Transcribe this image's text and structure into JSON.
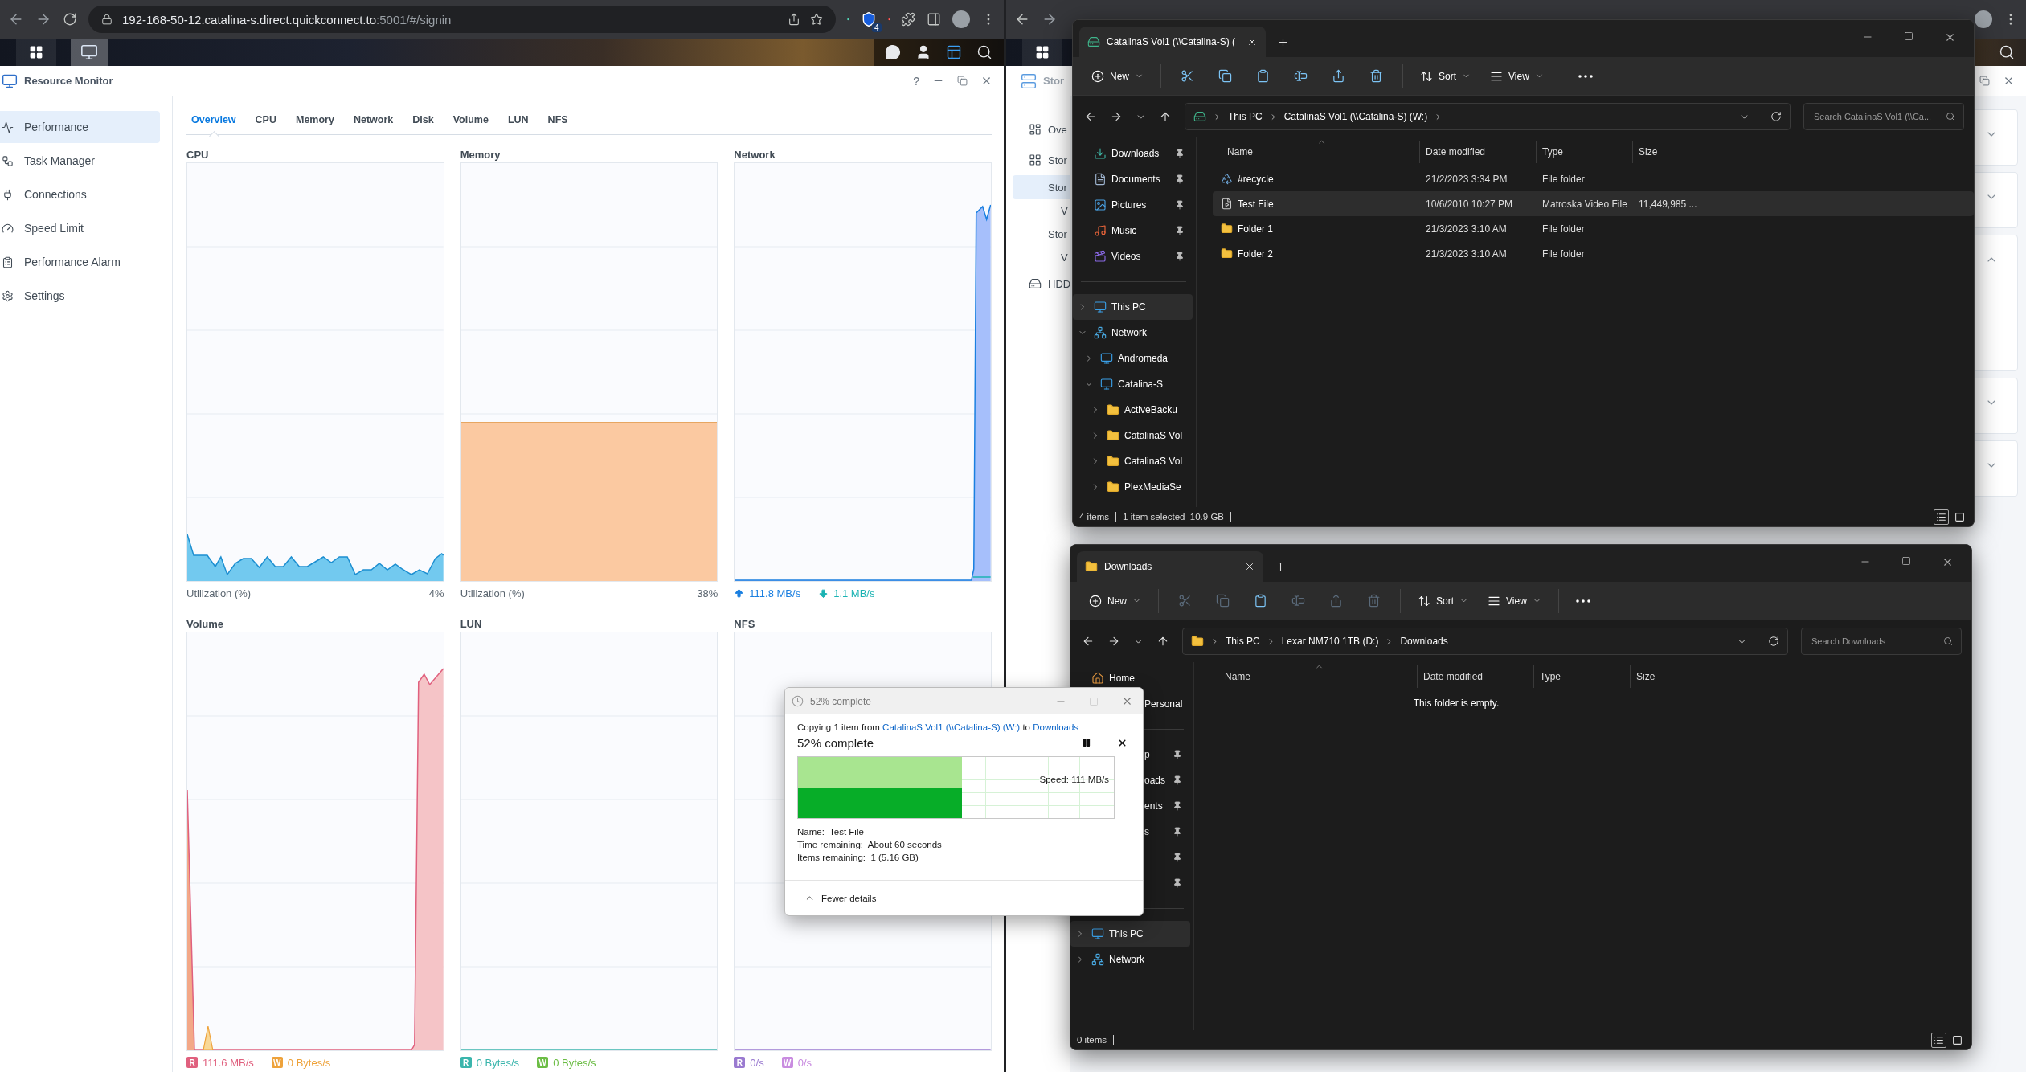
{
  "left_browser": {
    "url_host": "192-168-50-12.catalina-s.direct.quickconnect.to",
    "url_path": ":5001/#/signin",
    "extension_badge": "4"
  },
  "resource_monitor": {
    "title": "Resource Monitor",
    "help": "?",
    "sidebar": [
      {
        "label": "Performance",
        "kind": "performance",
        "selected": true
      },
      {
        "label": "Task Manager",
        "kind": "tasks",
        "selected": false
      },
      {
        "label": "Connections",
        "kind": "connections",
        "selected": false
      },
      {
        "label": "Speed Limit",
        "kind": "speed",
        "selected": false
      },
      {
        "label": "Performance Alarm",
        "kind": "alarm",
        "selected": false
      },
      {
        "label": "Settings",
        "kind": "settings",
        "selected": false
      }
    ],
    "tabs": [
      {
        "label": "Overview",
        "selected": true
      },
      {
        "label": "CPU",
        "selected": false
      },
      {
        "label": "Memory",
        "selected": false
      },
      {
        "label": "Network",
        "selected": false
      },
      {
        "label": "Disk",
        "selected": false
      },
      {
        "label": "Volume",
        "selected": false
      },
      {
        "label": "LUN",
        "selected": false
      },
      {
        "label": "NFS",
        "selected": false
      }
    ],
    "panels": [
      {
        "title": "CPU",
        "kind": "cpu",
        "caption": "Utilization (%)",
        "value": "4%"
      },
      {
        "title": "Memory",
        "kind": "memory",
        "caption": "Utilization (%)",
        "value": "38%"
      },
      {
        "title": "Network",
        "kind": "network",
        "legend": [
          {
            "kind": "up",
            "text": "111.8 MB/s",
            "color": "#1a7fe0"
          },
          {
            "kind": "down",
            "text": "1.1 MB/s",
            "color": "#1bb3b3"
          }
        ]
      },
      {
        "title": "Volume",
        "kind": "volume",
        "legend": [
          {
            "kind": "badge",
            "badge": "R",
            "text": "111.6 MB/s",
            "color": "#e0607e"
          },
          {
            "kind": "badge",
            "badge": "W",
            "text": "0 Bytes/s",
            "color": "#eea23a"
          }
        ]
      },
      {
        "title": "LUN",
        "kind": "flat",
        "legend": [
          {
            "kind": "badge",
            "badge": "R",
            "text": "0 Bytes/s",
            "color": "#3ab5ac"
          },
          {
            "kind": "badge",
            "badge": "W",
            "text": "0 Bytes/s",
            "color": "#6cbd45"
          }
        ]
      },
      {
        "title": "NFS",
        "kind": "flat",
        "legend": [
          {
            "kind": "badge",
            "badge": "R",
            "text": "0/s",
            "color": "#9a7ad0"
          },
          {
            "kind": "badge",
            "badge": "W",
            "text": "0/s",
            "color": "#c98ce0"
          }
        ]
      }
    ]
  },
  "right_browser": {
    "window_title": "Stor",
    "sidebar": [
      {
        "label": "Ove",
        "kind": "main",
        "selected": false
      },
      {
        "label": "Stor",
        "kind": "main",
        "selected": false
      },
      {
        "label": "Stor",
        "kind": "group",
        "selected": true
      },
      {
        "label": "V",
        "kind": "sub",
        "selected": false
      },
      {
        "label": "Stor",
        "kind": "group",
        "selected": false
      },
      {
        "label": "V",
        "kind": "sub",
        "selected": false
      },
      {
        "label": "HDD",
        "kind": "main",
        "selected": false
      }
    ],
    "cards": [
      {
        "expanded": false
      },
      {
        "expanded": false
      },
      {
        "expanded": true
      },
      {
        "expanded": false
      },
      {
        "expanded": false
      }
    ]
  },
  "explorers": [
    {
      "tab": {
        "title": "CatalinaS Vol1 (\\\\Catalina-S) (",
        "kind": "drive"
      },
      "menus": [
        "New",
        "Sort",
        "View"
      ],
      "actions": [
        {
          "kind": "cut",
          "disabled": false
        },
        {
          "kind": "copy",
          "disabled": false
        },
        {
          "kind": "paste",
          "disabled": false
        },
        {
          "kind": "rename",
          "disabled": false
        },
        {
          "kind": "share",
          "disabled": false
        },
        {
          "kind": "delete",
          "disabled": false
        }
      ],
      "location": {
        "kind": "drive",
        "path": [
          "This PC",
          "CatalinaS Vol1 (\\\\Catalina-S) (W:)"
        ]
      },
      "search_placeholder": "Search CatalinaS Vol1 (\\\\Ca...",
      "nav_groups": [
        [
          {
            "label": "Downloads",
            "kind": "download",
            "pinned": true,
            "selected": false
          },
          {
            "label": "Documents",
            "kind": "document",
            "pinned": true,
            "selected": false
          },
          {
            "label": "Pictures",
            "kind": "picture",
            "pinned": true,
            "selected": false
          },
          {
            "label": "Music",
            "kind": "music",
            "pinned": true,
            "selected": false
          },
          {
            "label": "Videos",
            "kind": "video",
            "pinned": true,
            "selected": false
          }
        ],
        [
          {
            "label": "This PC",
            "kind": "pc",
            "expanded": false,
            "pinned": false,
            "selected": true
          },
          {
            "label": "Network",
            "kind": "network",
            "expanded": true,
            "pinned": false,
            "selected": false,
            "children": [
              {
                "label": "Andromeda",
                "kind": "computer",
                "expanded": false,
                "pinned": false,
                "selected": false
              },
              {
                "label": "Catalina-S",
                "kind": "computer",
                "expanded": true,
                "pinned": false,
                "selected": false,
                "children": [
                  {
                    "label": "ActiveBacku",
                    "kind": "folder",
                    "expanded": false,
                    "pinned": false,
                    "selected": false
                  },
                  {
                    "label": "CatalinaS Vol",
                    "kind": "folder",
                    "expanded": false,
                    "pinned": false,
                    "selected": false
                  },
                  {
                    "label": "CatalinaS Vol",
                    "kind": "folder",
                    "expanded": false,
                    "pinned": false,
                    "selected": false
                  },
                  {
                    "label": "PlexMediaSe",
                    "kind": "folder",
                    "expanded": false,
                    "pinned": false,
                    "selected": false
                  }
                ]
              }
            ]
          }
        ]
      ],
      "columns": [
        "Name",
        "Date modified",
        "Type",
        "Size"
      ],
      "rows": [
        {
          "name": "#recycle",
          "kind": "recycle",
          "date": "21/2/2023 3:34 PM",
          "type": "File folder",
          "selected": false
        },
        {
          "name": "Test File",
          "kind": "video",
          "date": "10/6/2010 10:27 PM",
          "type": "Matroska Video File",
          "size": "11,449,985 ...",
          "selected": true
        },
        {
          "name": "Folder 1",
          "kind": "folder",
          "date": "21/3/2023 3:10 AM",
          "type": "File folder",
          "selected": false
        },
        {
          "name": "Folder 2",
          "kind": "folder",
          "date": "21/3/2023 3:10 AM",
          "type": "File folder",
          "selected": false
        }
      ],
      "status": [
        "4 items",
        "1 item selected  10.9 GB"
      ],
      "views": [
        {
          "kind": "details",
          "selected": true
        },
        {
          "kind": "tiles",
          "selected": false
        }
      ]
    },
    {
      "tab": {
        "title": "Downloads",
        "kind": "folder"
      },
      "menus": [
        "New",
        "Sort",
        "View"
      ],
      "actions": [
        {
          "kind": "cut",
          "disabled": true
        },
        {
          "kind": "copy",
          "disabled": true
        },
        {
          "kind": "paste",
          "disabled": false
        },
        {
          "kind": "rename",
          "disabled": true
        },
        {
          "kind": "share",
          "disabled": true
        },
        {
          "kind": "delete",
          "disabled": true
        }
      ],
      "location": {
        "kind": "folder",
        "path": [
          "This PC",
          "Lexar NM710 1TB (D:)",
          "Downloads"
        ]
      },
      "search_placeholder": "Search Downloads",
      "nav_groups": [
        [
          {
            "label": "Home",
            "kind": "home",
            "pinned": false,
            "selected": false
          },
          {
            "label": "Personal",
            "kind": "partial",
            "pinned": false,
            "selected": false
          }
        ],
        [
          {
            "label": "p",
            "kind": "partial",
            "pinned": true,
            "selected": false
          },
          {
            "label": "oads",
            "kind": "partial",
            "pinned": true,
            "selected": false
          },
          {
            "label": "ents",
            "kind": "partial",
            "pinned": true,
            "selected": false
          },
          {
            "label": "s",
            "kind": "partial",
            "pinned": true,
            "selected": false
          },
          {
            "kind": "partial",
            "pinned": true,
            "selected": false
          },
          {
            "kind": "partial",
            "pinned": true,
            "selected": false
          }
        ],
        [
          {
            "label": "This PC",
            "kind": "pc",
            "expanded": false,
            "pinned": false,
            "selected": true
          },
          {
            "label": "Network",
            "kind": "network",
            "expanded": false,
            "pinned": false,
            "selected": false
          }
        ]
      ],
      "columns": [
        "Name",
        "Date modified",
        "Type",
        "Size"
      ],
      "empty_message": "This folder is empty.",
      "status": [
        "0 items"
      ],
      "views": [
        {
          "kind": "details",
          "selected": true
        },
        {
          "kind": "tiles",
          "selected": false
        }
      ]
    }
  ],
  "copy_dialog": {
    "title": "52% complete",
    "message_start": "Copying 1 item from",
    "source": "CatalinaS Vol1 (\\\\Catalina-S) (W:)",
    "message_join": "to",
    "destination": "Downloads",
    "heading": "52% complete",
    "level": 0.52,
    "speed": "Speed: 111 MB/s",
    "details": [
      "Name:  Test File",
      "Time remaining:  About 60 seconds",
      "Items remaining:  1 (5.16 GB)"
    ],
    "toggle": "Fewer details"
  }
}
